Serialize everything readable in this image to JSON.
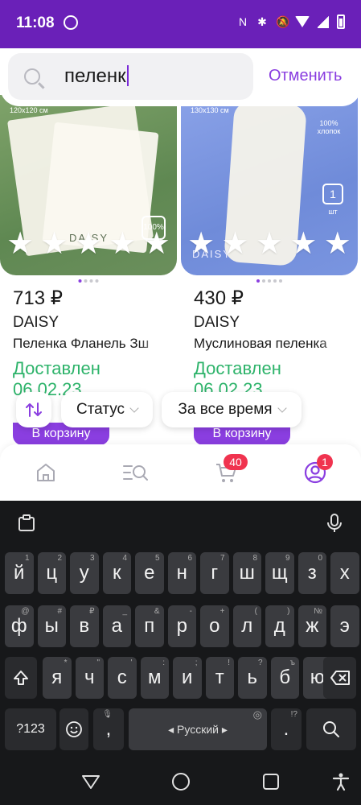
{
  "status_bar": {
    "time": "11:08"
  },
  "search": {
    "query": "пеленк",
    "cancel_label": "Отменить"
  },
  "products": [
    {
      "price": "713 ₽",
      "brand": "DAISY",
      "title": "Пеленка Фланель Зш",
      "status": "Доставлен",
      "date": "06.02.23",
      "cart_label": "В корзину",
      "image": {
        "size_tag": "120x120 см",
        "brand_tag": "DAISY",
        "cotton_tag": "100%"
      }
    },
    {
      "price": "430 ₽",
      "brand": "DAISY",
      "title": "Муслиновая пеленка",
      "status": "Доставлен",
      "date": "06.02.23",
      "cart_label": "В корзину",
      "image": {
        "size_tag": "130x130 см",
        "brand_tag": "DAISY",
        "cotton_tag": "100% хлопок",
        "count_tag": "1",
        "count_unit": "шт"
      }
    }
  ],
  "filters": {
    "status_label": "Статус",
    "period_label": "За все время"
  },
  "bottom_nav": {
    "cart_badge": "40",
    "profile_badge": "1"
  },
  "keyboard": {
    "row1": [
      {
        "k": "й",
        "h": "1"
      },
      {
        "k": "ц",
        "h": "2"
      },
      {
        "k": "у",
        "h": "3"
      },
      {
        "k": "к",
        "h": "4"
      },
      {
        "k": "е",
        "h": "5"
      },
      {
        "k": "н",
        "h": "6"
      },
      {
        "k": "г",
        "h": "7"
      },
      {
        "k": "ш",
        "h": "8"
      },
      {
        "k": "щ",
        "h": "9"
      },
      {
        "k": "з",
        "h": "0"
      },
      {
        "k": "х",
        "h": ""
      }
    ],
    "row2": [
      {
        "k": "ф",
        "h": "@"
      },
      {
        "k": "ы",
        "h": "#"
      },
      {
        "k": "в",
        "h": "₽"
      },
      {
        "k": "а",
        "h": "_"
      },
      {
        "k": "п",
        "h": "&"
      },
      {
        "k": "р",
        "h": "-"
      },
      {
        "k": "о",
        "h": "+"
      },
      {
        "k": "л",
        "h": "("
      },
      {
        "k": "д",
        "h": ")"
      },
      {
        "k": "ж",
        "h": "№"
      },
      {
        "k": "э",
        "h": ""
      }
    ],
    "row3": [
      {
        "k": "я",
        "h": "*"
      },
      {
        "k": "ч",
        "h": "\""
      },
      {
        "k": "с",
        "h": "'"
      },
      {
        "k": "м",
        "h": ":"
      },
      {
        "k": "и",
        "h": ";"
      },
      {
        "k": "т",
        "h": "!"
      },
      {
        "k": "ь",
        "h": "?"
      },
      {
        "k": "б",
        "h": "ъ"
      },
      {
        "k": "ю",
        "h": "ё"
      }
    ],
    "symbols_label": "?123",
    "comma": ",",
    "space_label": "◂ Русский ▸",
    "period": ".",
    "period_hint": "!?"
  }
}
